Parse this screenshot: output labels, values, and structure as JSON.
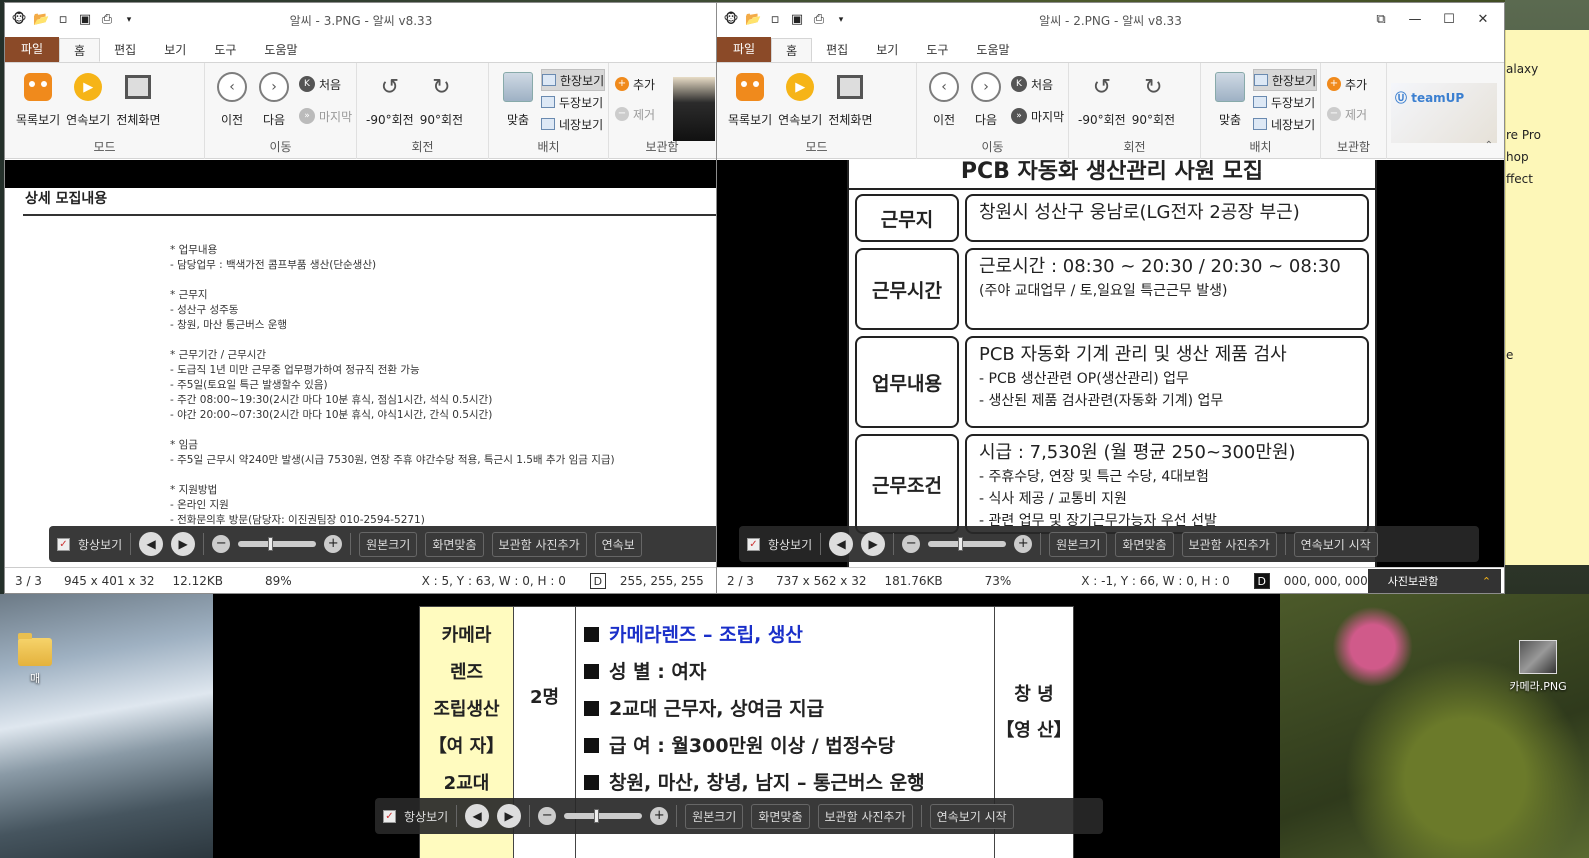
{
  "desktop": {
    "sticky_lines": [
      "alaxy",
      "",
      "",
      "re Pro",
      "hop",
      "ffect",
      "",
      "",
      "",
      "",
      "",
      "",
      "",
      "e"
    ],
    "icons": [
      {
        "label": "매"
      },
      {
        "label": "카메라.PNG"
      }
    ]
  },
  "win1": {
    "title": "알씨 - 3.PNG - 알씨 v8.33",
    "tabs": [
      "파일",
      "홈",
      "편집",
      "보기",
      "도구",
      "도움말"
    ],
    "mode": {
      "label": "모드",
      "buttons": [
        "목록보기",
        "연속보기",
        "전체화면"
      ]
    },
    "move": {
      "label": "이동",
      "buttons": [
        "이전",
        "다음"
      ],
      "first": "처음",
      "last": "마지막"
    },
    "rotate": {
      "label": "회전",
      "buttons": [
        "-90°회전",
        "90°회전"
      ]
    },
    "layout": {
      "label": "배치",
      "fit": "맞춤",
      "options": [
        "한장보기",
        "두장보기",
        "네장보기"
      ]
    },
    "storage": {
      "label": "보관함",
      "add": "추가",
      "remove": "제거"
    },
    "doc": {
      "heading": "상세 모집내용",
      "lines": [
        "* 업무내용",
        "- 담당업무 : 백색가전 콤프부품 생산(단순생산)",
        "",
        "* 근무지",
        "- 성산구 성주동",
        "- 창원, 마산 통근버스 운행",
        "",
        "* 근무기간 / 근무시간",
        "- 도급직 1년 미만 근무중 업무평가하여 정규직 전환 가능",
        "- 주5일(토요일 특근 발생할수 있음)",
        "- 주간 08:00~19:30(2시간 마다 10분 휴식, 점심1시간, 석식 0.5시간)",
        "- 야간 20:00~07:30(2시간 마다 10분 휴식, 야식1시간, 간식 0.5시간)",
        "",
        "* 임금",
        "- 주5일 근무시 약240만 발생(시급 7530원, 연장 주휴 야간수당 적용, 특근시 1.5배 추가 임금 지급)",
        "",
        "* 지원방법",
        "- 온라인 지원",
        "- 전화문의후 방문(담당자: 이진권팀장 010-2594-5271)"
      ]
    },
    "toolbar": {
      "always": "항상보기",
      "orig": "원본크기",
      "fit": "화면맞춤",
      "add": "보관함 사진추가",
      "slideshow": "연속보"
    },
    "status": {
      "page": "3 / 3",
      "dims": "945 x 401 x 32",
      "size": "12.12KB",
      "zoom": "89%",
      "coords": "X : 5, Y : 63, W : 0, H : 0",
      "d": "D",
      "rgb": "255, 255, 255",
      "extra": "사"
    }
  },
  "win2": {
    "title": "알씨 - 2.PNG - 알씨 v8.33",
    "tabs": [
      "파일",
      "홈",
      "편집",
      "보기",
      "도구",
      "도움말"
    ],
    "mode": {
      "label": "모드",
      "buttons": [
        "목록보기",
        "연속보기",
        "전체화면"
      ]
    },
    "move": {
      "label": "이동",
      "buttons": [
        "이전",
        "다음"
      ],
      "first": "처음",
      "last": "마지막"
    },
    "rotate": {
      "label": "회전",
      "buttons": [
        "-90°회전",
        "90°회전"
      ]
    },
    "layout": {
      "label": "배치",
      "fit": "맞춤",
      "options": [
        "한장보기",
        "두장보기",
        "네장보기"
      ]
    },
    "storage": {
      "label": "보관함",
      "add": "추가",
      "remove": "제거"
    },
    "teamup": "teamUP",
    "doc": {
      "title": "PCB 자동화 생산관리 사원 모집",
      "rows": [
        {
          "label": "근무지",
          "main": "창원시 성산구 웅남로(LG전자 2공장 부근)",
          "subs": []
        },
        {
          "label": "근무시간",
          "main": "근로시간 : 08:30 ~ 20:30 / 20:30 ~ 08:30",
          "subs": [
            "(주야 교대업무 / 토,일요일 특근근무 발생)"
          ]
        },
        {
          "label": "업무내용",
          "main": "PCB 자동화 기계 관리 및 생산 제품 검사",
          "subs": [
            "- PCB 생산관련 OP(생산관리) 업무",
            "- 생산된 제품 검사관련(자동화 기계) 업무"
          ]
        },
        {
          "label": "근무조건",
          "main": "시급 : 7,530원 (월 평균 250~300만원)",
          "subs": [
            "- 주휴수당, 연장 및 특근 수당, 4대보험",
            "- 식사 제공 / 교통비 지원",
            "- 관련 업무 및 장기근무가능자 우선 선발"
          ]
        }
      ]
    },
    "toolbar": {
      "always": "항상보기",
      "orig": "원본크기",
      "fit": "화면맞춤",
      "add": "보관함 사진추가",
      "slideshow": "연속보기 시작"
    },
    "status": {
      "page": "2 / 3",
      "dims": "737 x 562 x 32",
      "size": "181.76KB",
      "zoom": "73%",
      "coords": "X : -1, Y : 66, W : 0, H : 0",
      "d": "D",
      "rgb": "000, 000, 000",
      "storage": "사진보관함"
    }
  },
  "win3": {
    "col1": [
      "카메라",
      "렌즈",
      "조립생산",
      "【여 자】",
      "2교대"
    ],
    "col2": "2명",
    "lines": [
      "카메라렌즈 – 조립, 생산",
      "성 별 : 여자",
      "2교대 근무자, 상여금 지급",
      "급   여 : 월300만원 이상 / 법정수당",
      "창원, 마산, 창녕, 남지 – 통근버스 운행"
    ],
    "col4": [
      "창 녕",
      "【영 산】"
    ],
    "toolbar": {
      "always": "항상보기",
      "orig": "원본크기",
      "fit": "화면맞춤",
      "add": "보관함 사진추가",
      "slideshow": "연속보기 시작"
    }
  }
}
